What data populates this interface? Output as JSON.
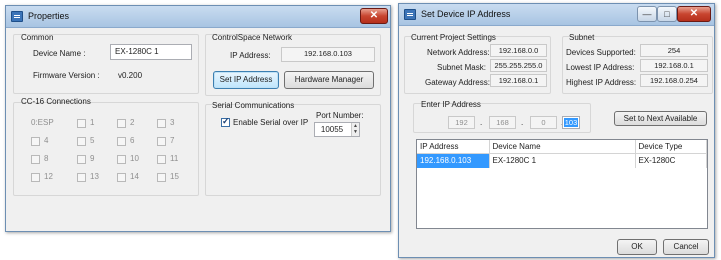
{
  "properties": {
    "title": "Properties",
    "close_glyph": "✕",
    "common": {
      "label": "Common",
      "device_name_label": "Device Name :",
      "device_name_value": "EX-1280C 1",
      "firmware_label": "Firmware Version :",
      "firmware_value": "v0.200"
    },
    "connections": {
      "label": "CC-16 Connections",
      "items": [
        "0:ESP",
        "1",
        "2",
        "3",
        "4",
        "5",
        "6",
        "7",
        "8",
        "9",
        "10",
        "11",
        "12",
        "13",
        "14",
        "15"
      ]
    },
    "network": {
      "label": "ControlSpace Network",
      "ip_label": "IP Address:",
      "ip_value": "192.168.0.103",
      "set_ip_button": "Set IP Address",
      "hardware_button": "Hardware Manager"
    },
    "serial": {
      "label": "Serial Communications",
      "enable_label": "Enable Serial over IP",
      "enable_checked": true,
      "port_label": "Port Number:",
      "port_value": "10055"
    }
  },
  "setip": {
    "title": "Set Device IP Address",
    "controls": {
      "minimize": "—",
      "maximize": "□",
      "close": "✕"
    },
    "current": {
      "label": "Current Project Settings",
      "network_label": "Network Address:",
      "network_value": "192.168.0.0",
      "subnet_label": "Subnet Mask:",
      "subnet_value": "255.255.255.0",
      "gateway_label": "Gateway Address:",
      "gateway_value": "192.168.0.1"
    },
    "subnet": {
      "label": "Subnet",
      "devices_label": "Devices Supported:",
      "devices_value": "254",
      "lowest_label": "Lowest IP Address:",
      "lowest_value": "192.168.0.1",
      "highest_label": "Highest IP Address:",
      "highest_value": "192.168.0.254"
    },
    "enter_ip": {
      "label": "Enter IP Address",
      "octets": [
        "192",
        "168",
        "0",
        "103"
      ],
      "dot": ".",
      "next_button": "Set to Next Available"
    },
    "table": {
      "headers": [
        "IP Address",
        "Device Name",
        "Device Type"
      ],
      "rows": [
        [
          "192.168.0.103",
          "EX-1280C 1",
          "EX-1280C"
        ]
      ]
    },
    "ok_button": "OK",
    "cancel_button": "Cancel"
  }
}
